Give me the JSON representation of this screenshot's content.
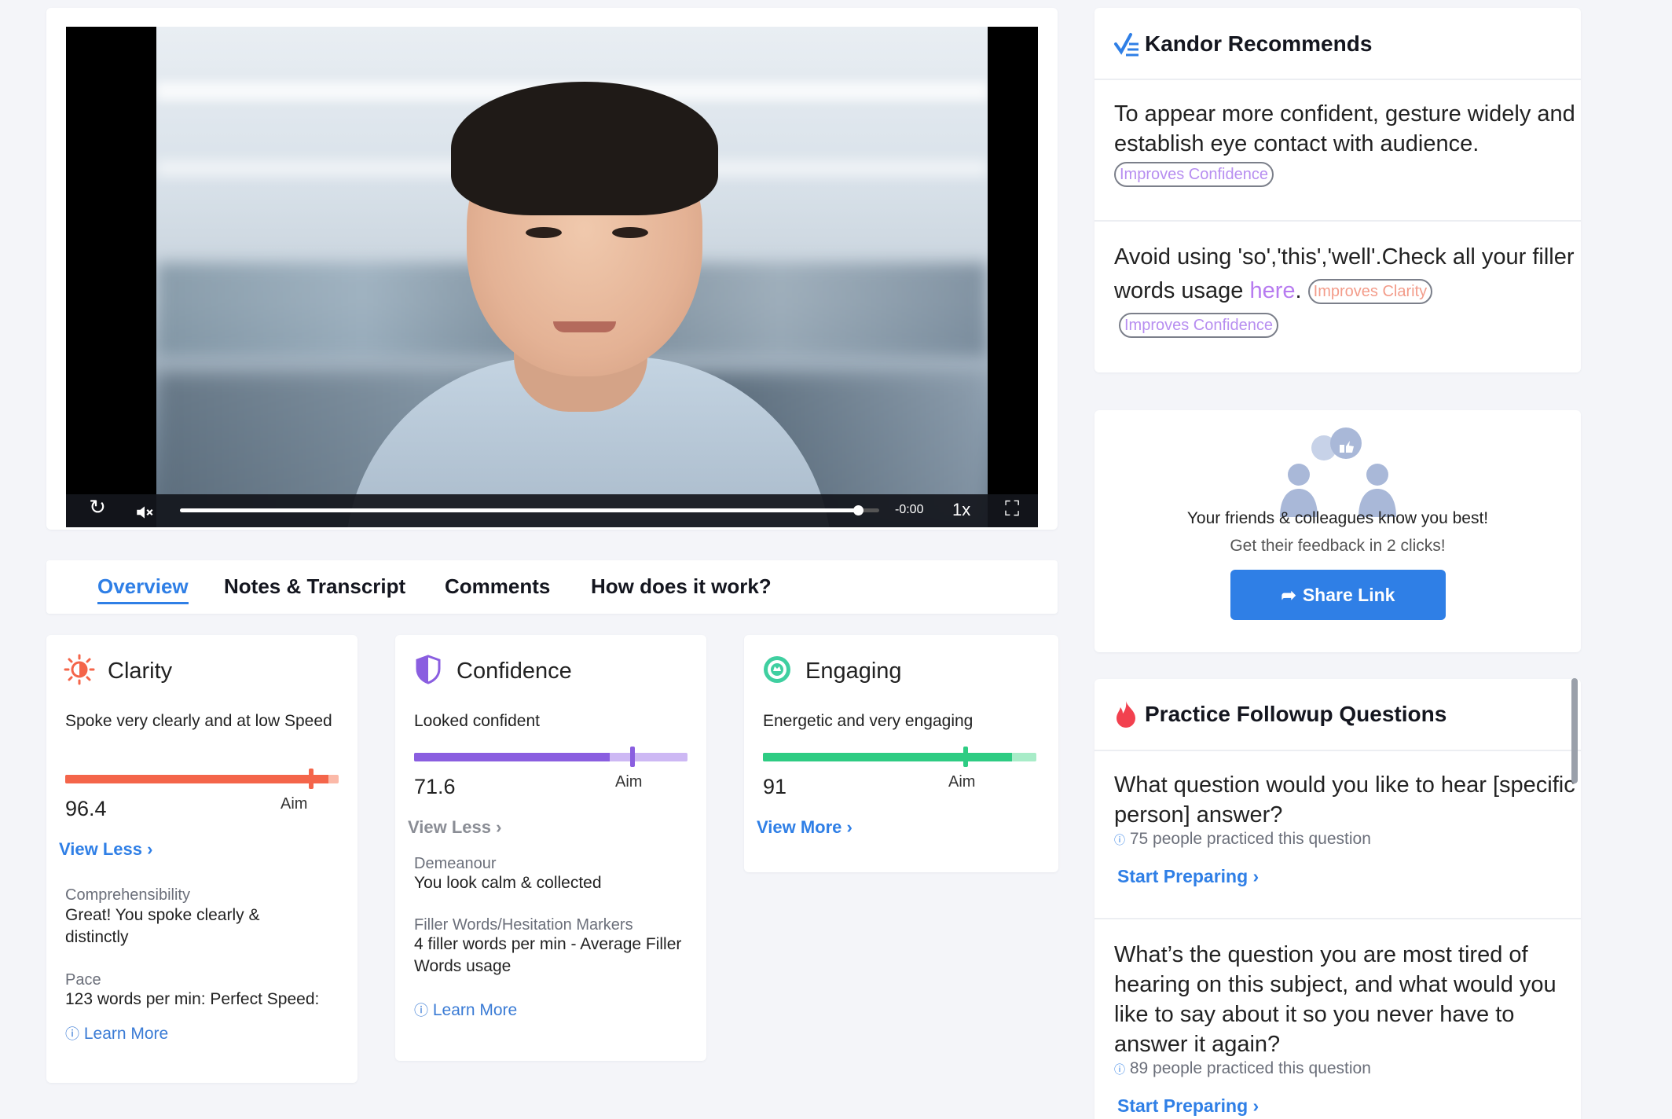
{
  "video": {
    "time": "-0:00",
    "speed": "1x",
    "progress_percent": 97
  },
  "tabs": [
    {
      "label": "Overview"
    },
    {
      "label": "Notes & Transcript"
    },
    {
      "label": "Comments"
    },
    {
      "label": "How does it work?"
    }
  ],
  "metrics": {
    "clarity": {
      "title": "Clarity",
      "description": "Spoke very clearly and at low Speed",
      "score": "96.4",
      "score_fraction": 0.964,
      "aim_fraction": 0.9,
      "aim_label": "Aim",
      "toggle": "View Less ›",
      "details": [
        {
          "label": "Comprehensibility",
          "value": "Great! You spoke clearly & distinctly"
        },
        {
          "label": "Pace",
          "value": "123 words per min: Perfect Speed:"
        }
      ],
      "learn_more": "Learn More",
      "color": "#f4654a",
      "track_color": "#fbb9a8"
    },
    "confidence": {
      "title": "Confidence",
      "description": "Looked confident",
      "score": "71.6",
      "score_fraction": 0.716,
      "aim_fraction": 0.8,
      "aim_label": "Aim",
      "toggle": "View Less ›",
      "details": [
        {
          "label": "Demeanour",
          "value": "You look calm & collected"
        },
        {
          "label": "Filler Words/Hesitation Markers",
          "value": "4 filler words per min - Average Filler Words usage"
        }
      ],
      "learn_more": "Learn More",
      "color": "#8a5ee0",
      "track_color": "#cdb8f4"
    },
    "engaging": {
      "title": "Engaging",
      "description": "Energetic and very engaging",
      "score": "91",
      "score_fraction": 0.91,
      "aim_fraction": 0.74,
      "aim_label": "Aim",
      "toggle": "View More ›",
      "color": "#2ecc83",
      "track_color": "#a8ecc8"
    }
  },
  "recommendations": {
    "title": "Kandor Recommends",
    "items": [
      {
        "text": "To appear more confident, gesture widely and establish eye contact with audience.",
        "tags": [
          "Improves Confidence"
        ]
      },
      {
        "text_before": "Avoid using 'so','this','well'.Check all your filler words usage ",
        "link": "here",
        "text_after": ".",
        "tags": [
          "Improves Clarity",
          "Improves Confidence"
        ]
      }
    ]
  },
  "share": {
    "line1": "Your friends & colleagues know you best!",
    "line2": "Get their feedback in 2 clicks!",
    "button": "Share Link"
  },
  "followup": {
    "title": "Practice Followup Questions",
    "questions": [
      {
        "text": "What question would you like to hear [specific person] answer?",
        "meta": "75 people practiced this question",
        "cta": "Start Preparing ›"
      },
      {
        "text": "What’s the question you are most tired of hearing on this subject, and what would you like to say about it so you never have to answer it again?",
        "meta": "89 people practiced this question",
        "cta": "Start Preparing ›"
      }
    ]
  },
  "colors": {
    "accent": "#2f7fe6",
    "link_purple": "#b77bf0"
  }
}
